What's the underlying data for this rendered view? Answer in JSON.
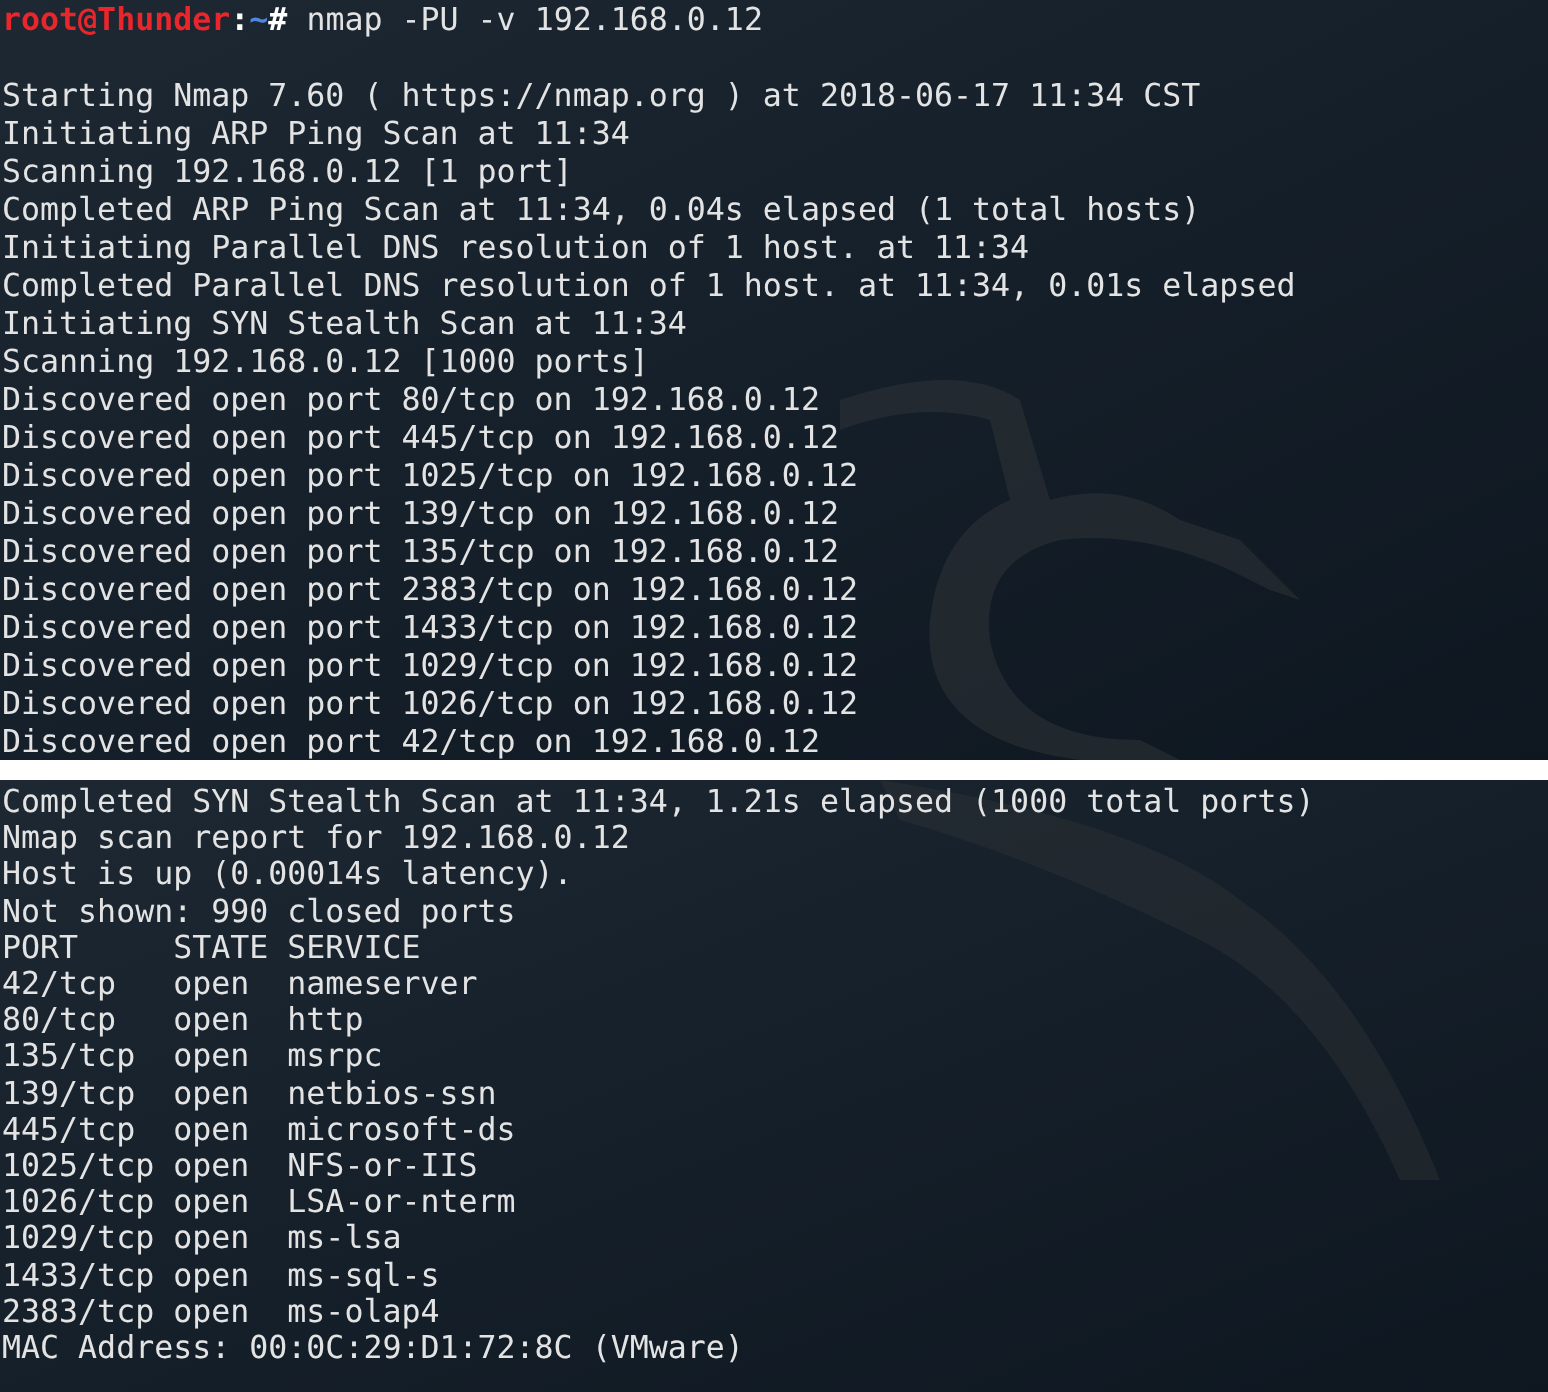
{
  "top_pane": {
    "prompt": {
      "user_host": "root@Thunder",
      "separator": ":",
      "path": "~",
      "symbol": "#",
      "command": "nmap -PU -v 192.168.0.12"
    },
    "lines": [
      "Starting Nmap 7.60 ( https://nmap.org ) at 2018-06-17 11:34 CST",
      "Initiating ARP Ping Scan at 11:34",
      "Scanning 192.168.0.12 [1 port]",
      "Completed ARP Ping Scan at 11:34, 0.04s elapsed (1 total hosts)",
      "Initiating Parallel DNS resolution of 1 host. at 11:34",
      "Completed Parallel DNS resolution of 1 host. at 11:34, 0.01s elapsed",
      "Initiating SYN Stealth Scan at 11:34",
      "Scanning 192.168.0.12 [1000 ports]",
      "Discovered open port 80/tcp on 192.168.0.12",
      "Discovered open port 445/tcp on 192.168.0.12",
      "Discovered open port 1025/tcp on 192.168.0.12",
      "Discovered open port 139/tcp on 192.168.0.12",
      "Discovered open port 135/tcp on 192.168.0.12",
      "Discovered open port 2383/tcp on 192.168.0.12",
      "Discovered open port 1433/tcp on 192.168.0.12",
      "Discovered open port 1029/tcp on 192.168.0.12",
      "Discovered open port 1026/tcp on 192.168.0.12",
      "Discovered open port 42/tcp on 192.168.0.12"
    ]
  },
  "bottom_pane": {
    "lines": [
      "Completed SYN Stealth Scan at 11:34, 1.21s elapsed (1000 total ports)",
      "Nmap scan report for 192.168.0.12",
      "Host is up (0.00014s latency).",
      "Not shown: 990 closed ports",
      "PORT     STATE SERVICE",
      "42/tcp   open  nameserver",
      "80/tcp   open  http",
      "135/tcp  open  msrpc",
      "139/tcp  open  netbios-ssn",
      "445/tcp  open  microsoft-ds",
      "1025/tcp open  NFS-or-IIS",
      "1026/tcp open  LSA-or-nterm",
      "1029/tcp open  ms-lsa",
      "1433/tcp open  ms-sql-s",
      "2383/tcp open  ms-olap4",
      "MAC Address: 00:0C:29:D1:72:8C (VMware)"
    ]
  }
}
